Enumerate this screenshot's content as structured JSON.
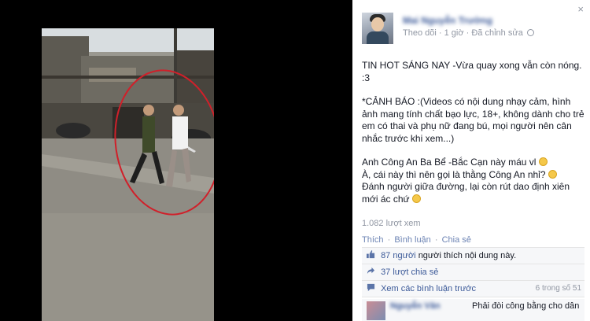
{
  "close_label": "×",
  "post": {
    "author_name": "Mai Nguyễn Trường",
    "meta": {
      "follow": "Theo dõi",
      "time": "1 giờ",
      "edited": "Đã chỉnh sửa"
    },
    "paragraphs": [
      "TIN HOT SÁNG NAY -Vừa quay xong vẫn còn nóng. :3",
      "*CẢNH BÁO :(Videos có nội dung nhạy cảm, hình ảnh mang tính chất bạo lực, 18+, không dành cho trẻ em có thai và phụ nữ đang bú, mọi người nên cân nhắc trước khi xem...)"
    ],
    "lines": [
      "Anh Công An Ba Bể -Bắc Cạn này máu vl",
      "À, cái này thì nên gọi là thằng Công An nhỉ?",
      "Đánh người giữa đường, lại còn rút dao định xiên mới ác chứ"
    ],
    "views": "1.082 lượt xem"
  },
  "actions": {
    "like": "Thích",
    "comment": "Bình luận",
    "share": "Chia sẻ",
    "sep": "·"
  },
  "ufi": {
    "likes_count": "87 người",
    "likes_text": "người thích nội dung này.",
    "shares": "37 lượt chia sẻ",
    "view_previous": "Xem các bình luận trước",
    "comment_count": "6 trong số 51"
  },
  "comment": {
    "author": "Nguyễn Văn",
    "text": "Phải đòi công bằng cho dân"
  },
  "colors": {
    "link": "#3b5998",
    "muted": "#9197a3",
    "panel_bg": "#ffffff",
    "media_bg": "#000000",
    "annotation_circle": "#d0202a"
  },
  "icons": [
    "close-icon",
    "globe-icon",
    "like-icon",
    "share-icon",
    "comment-icon",
    "smiley-emoji"
  ]
}
